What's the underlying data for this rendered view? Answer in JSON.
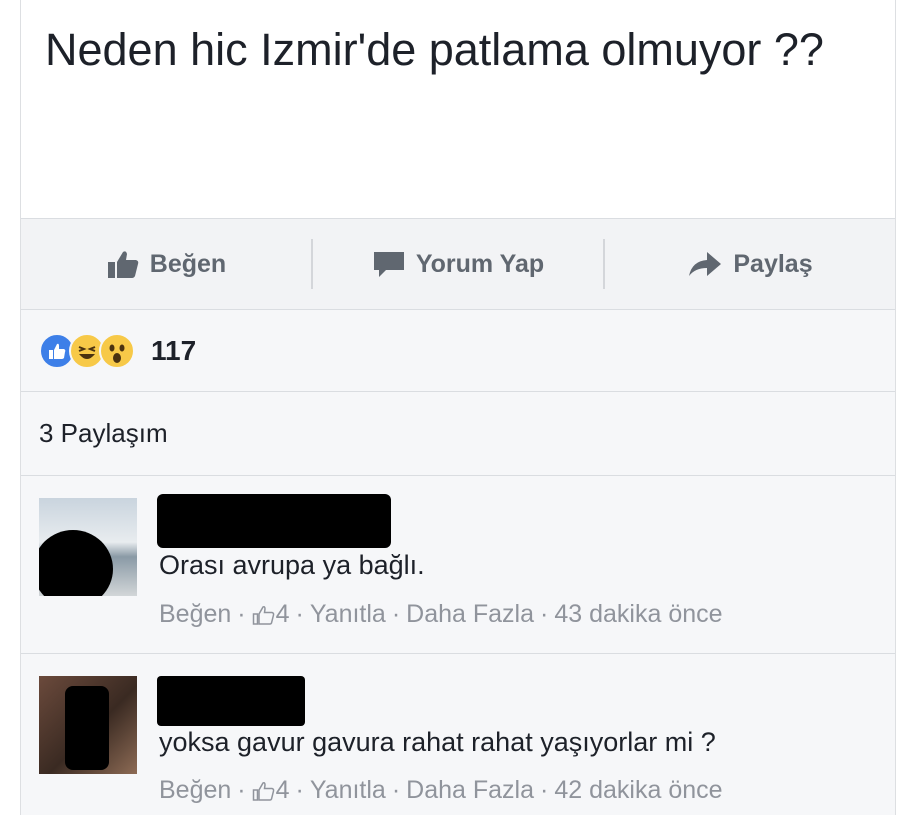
{
  "post": {
    "text": "Neden hic Izmir'de patlama olmuyor ??"
  },
  "actions": {
    "like_label": "Beğen",
    "comment_label": "Yorum Yap",
    "share_label": "Paylaş"
  },
  "reactions": {
    "count": "117",
    "types": [
      "like-icon",
      "haha-icon",
      "wow-icon"
    ]
  },
  "shares": {
    "label": "3 Paylaşım"
  },
  "comments": [
    {
      "text": "Orası avrupa ya bağlı.",
      "like_label": "Beğen",
      "like_count": "4",
      "reply_label": "Yanıtla",
      "more_label": "Daha Fazla",
      "time": "43 dakika önce"
    },
    {
      "text": "yoksa gavur gavura rahat rahat yaşıyorlar mi ?",
      "like_label": "Beğen",
      "like_count": "4",
      "reply_label": "Yanıtla",
      "more_label": "Daha Fazla",
      "time": "42 dakika önce"
    }
  ],
  "colors": {
    "background": "#ffffff",
    "panel": "#f6f7f9",
    "action_bar": "#f2f3f5",
    "muted_text": "#90949c",
    "like_blue": "#3d7fe8",
    "emoji_yellow": "#f7c948"
  }
}
